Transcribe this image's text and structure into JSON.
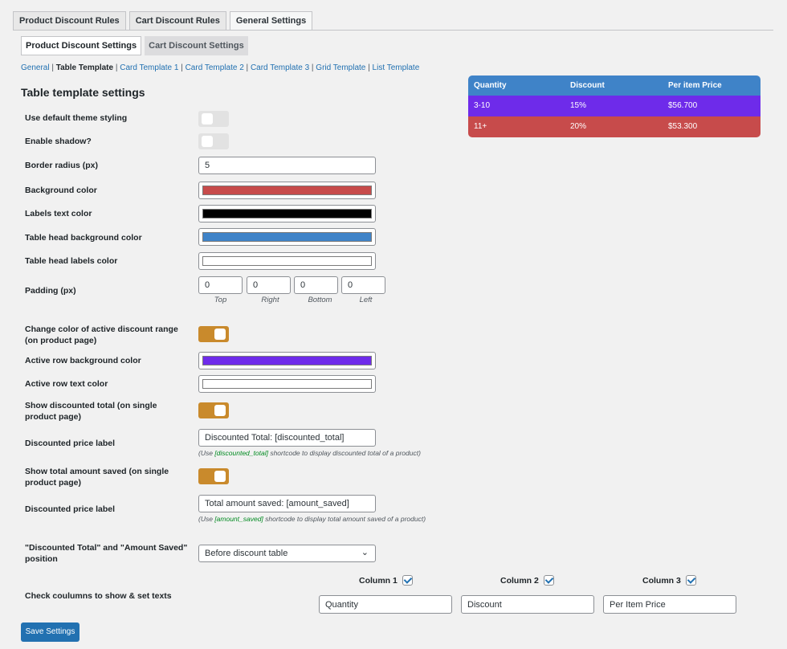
{
  "tabs": [
    "Product Discount Rules",
    "Cart Discount Rules",
    "General Settings"
  ],
  "subtabs": [
    "Product Discount Settings",
    "Cart Discount Settings"
  ],
  "links": [
    "General",
    "Table Template",
    "Card Template 1",
    "Card Template 2",
    "Card Template 3",
    "Grid Template",
    "List Template"
  ],
  "section_title": "Table template settings",
  "fields": {
    "default_theme": "Use default theme styling",
    "shadow": "Enable shadow?",
    "border_radius": {
      "label": "Border radius (px)",
      "value": "5"
    },
    "bg_color": {
      "label": "Background color",
      "color": "#c74b4b"
    },
    "labels_color": {
      "label": "Labels text color",
      "color": "#000000"
    },
    "head_bg": {
      "label": "Table head background color",
      "color": "#3f83c8"
    },
    "head_labels": {
      "label": "Table head labels color",
      "color": "#ffffff"
    },
    "padding": {
      "label": "Padding (px)",
      "top": "0",
      "right": "0",
      "bottom": "0",
      "left": "0",
      "captions": [
        "Top",
        "Right",
        "Bottom",
        "Left"
      ]
    },
    "active_range": "Change color of active discount range (on product page)",
    "active_bg": {
      "label": "Active row background color",
      "color": "#6e2bea"
    },
    "active_text": {
      "label": "Active row text color",
      "color": "#ffffff"
    },
    "show_total": "Show discounted total (on single product page)",
    "total_label": {
      "label": "Discounted price label",
      "value": "Discounted Total: [discounted_total]",
      "hint_pre": "(Use ",
      "hint_code": "[discounted_total]",
      "hint_post": " shortcode to display discounted total of a product)"
    },
    "show_saved": "Show total amount saved (on single product page)",
    "saved_label": {
      "label": "Discounted price label",
      "value": "Total amount saved: [amount_saved]",
      "hint_pre": "(Use ",
      "hint_code": "[amount_saved]",
      "hint_post": " shortcode to display total amount saved of a product)"
    },
    "position": {
      "label": "\"Discounted Total\" and \"Amount Saved\" position",
      "value": "Before discount table"
    },
    "columns": {
      "label": "Check coulumns to show & set texts",
      "headers": [
        "Column 1",
        "Column 2",
        "Column 3"
      ],
      "values": [
        "Quantity",
        "Discount",
        "Per Item Price"
      ]
    }
  },
  "save_label": "Save Settings",
  "preview": {
    "headers": [
      "Quantity",
      "Discount",
      "Per item Price"
    ],
    "rows": [
      [
        "3-10",
        "15%",
        "$56.700"
      ],
      [
        "11+",
        "20%",
        "$53.300"
      ]
    ]
  }
}
